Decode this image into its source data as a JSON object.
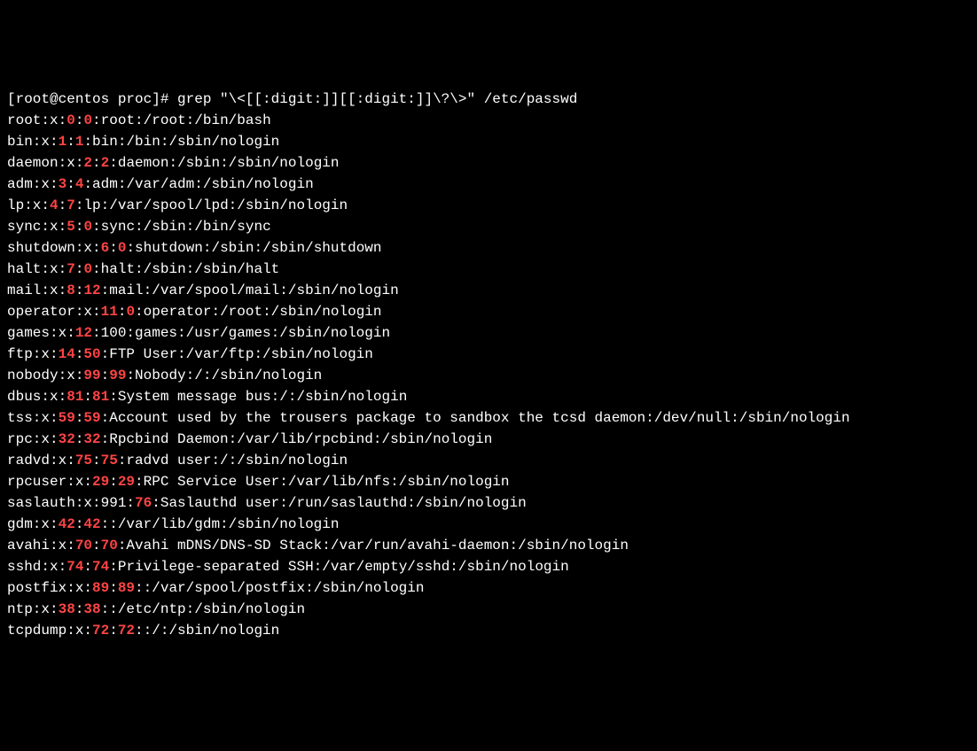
{
  "prompt": "[root@centos proc]# grep \"\\<[[:digit:]][[:digit:]]\\?\\>\" /etc/passwd",
  "lines": [
    {
      "segments": [
        {
          "t": "root:x:",
          "h": false
        },
        {
          "t": "0",
          "h": true
        },
        {
          "t": ":",
          "h": false
        },
        {
          "t": "0",
          "h": true
        },
        {
          "t": ":root:/root:/bin/bash",
          "h": false
        }
      ]
    },
    {
      "segments": [
        {
          "t": "bin:x:",
          "h": false
        },
        {
          "t": "1",
          "h": true
        },
        {
          "t": ":",
          "h": false
        },
        {
          "t": "1",
          "h": true
        },
        {
          "t": ":bin:/bin:/sbin/nologin",
          "h": false
        }
      ]
    },
    {
      "segments": [
        {
          "t": "daemon:x:",
          "h": false
        },
        {
          "t": "2",
          "h": true
        },
        {
          "t": ":",
          "h": false
        },
        {
          "t": "2",
          "h": true
        },
        {
          "t": ":daemon:/sbin:/sbin/nologin",
          "h": false
        }
      ]
    },
    {
      "segments": [
        {
          "t": "adm:x:",
          "h": false
        },
        {
          "t": "3",
          "h": true
        },
        {
          "t": ":",
          "h": false
        },
        {
          "t": "4",
          "h": true
        },
        {
          "t": ":adm:/var/adm:/sbin/nologin",
          "h": false
        }
      ]
    },
    {
      "segments": [
        {
          "t": "lp:x:",
          "h": false
        },
        {
          "t": "4",
          "h": true
        },
        {
          "t": ":",
          "h": false
        },
        {
          "t": "7",
          "h": true
        },
        {
          "t": ":lp:/var/spool/lpd:/sbin/nologin",
          "h": false
        }
      ]
    },
    {
      "segments": [
        {
          "t": "sync:x:",
          "h": false
        },
        {
          "t": "5",
          "h": true
        },
        {
          "t": ":",
          "h": false
        },
        {
          "t": "0",
          "h": true
        },
        {
          "t": ":sync:/sbin:/bin/sync",
          "h": false
        }
      ]
    },
    {
      "segments": [
        {
          "t": "shutdown:x:",
          "h": false
        },
        {
          "t": "6",
          "h": true
        },
        {
          "t": ":",
          "h": false
        },
        {
          "t": "0",
          "h": true
        },
        {
          "t": ":shutdown:/sbin:/sbin/shutdown",
          "h": false
        }
      ]
    },
    {
      "segments": [
        {
          "t": "halt:x:",
          "h": false
        },
        {
          "t": "7",
          "h": true
        },
        {
          "t": ":",
          "h": false
        },
        {
          "t": "0",
          "h": true
        },
        {
          "t": ":halt:/sbin:/sbin/halt",
          "h": false
        }
      ]
    },
    {
      "segments": [
        {
          "t": "mail:x:",
          "h": false
        },
        {
          "t": "8",
          "h": true
        },
        {
          "t": ":",
          "h": false
        },
        {
          "t": "12",
          "h": true
        },
        {
          "t": ":mail:/var/spool/mail:/sbin/nologin",
          "h": false
        }
      ]
    },
    {
      "segments": [
        {
          "t": "operator:x:",
          "h": false
        },
        {
          "t": "11",
          "h": true
        },
        {
          "t": ":",
          "h": false
        },
        {
          "t": "0",
          "h": true
        },
        {
          "t": ":operator:/root:/sbin/nologin",
          "h": false
        }
      ]
    },
    {
      "segments": [
        {
          "t": "games:x:",
          "h": false
        },
        {
          "t": "12",
          "h": true
        },
        {
          "t": ":100:games:/usr/games:/sbin/nologin",
          "h": false
        }
      ]
    },
    {
      "segments": [
        {
          "t": "ftp:x:",
          "h": false
        },
        {
          "t": "14",
          "h": true
        },
        {
          "t": ":",
          "h": false
        },
        {
          "t": "50",
          "h": true
        },
        {
          "t": ":FTP User:/var/ftp:/sbin/nologin",
          "h": false
        }
      ]
    },
    {
      "segments": [
        {
          "t": "nobody:x:",
          "h": false
        },
        {
          "t": "99",
          "h": true
        },
        {
          "t": ":",
          "h": false
        },
        {
          "t": "99",
          "h": true
        },
        {
          "t": ":Nobody:/:/sbin/nologin",
          "h": false
        }
      ]
    },
    {
      "segments": [
        {
          "t": "dbus:x:",
          "h": false
        },
        {
          "t": "81",
          "h": true
        },
        {
          "t": ":",
          "h": false
        },
        {
          "t": "81",
          "h": true
        },
        {
          "t": ":System message bus:/:/sbin/nologin",
          "h": false
        }
      ]
    },
    {
      "segments": [
        {
          "t": "tss:x:",
          "h": false
        },
        {
          "t": "59",
          "h": true
        },
        {
          "t": ":",
          "h": false
        },
        {
          "t": "59",
          "h": true
        },
        {
          "t": ":Account used by the trousers package to sandbox the tcsd daemon:/dev/null:/sbin/nologin",
          "h": false
        }
      ]
    },
    {
      "segments": [
        {
          "t": "rpc:x:",
          "h": false
        },
        {
          "t": "32",
          "h": true
        },
        {
          "t": ":",
          "h": false
        },
        {
          "t": "32",
          "h": true
        },
        {
          "t": ":Rpcbind Daemon:/var/lib/rpcbind:/sbin/nologin",
          "h": false
        }
      ]
    },
    {
      "segments": [
        {
          "t": "radvd:x:",
          "h": false
        },
        {
          "t": "75",
          "h": true
        },
        {
          "t": ":",
          "h": false
        },
        {
          "t": "75",
          "h": true
        },
        {
          "t": ":radvd user:/:/sbin/nologin",
          "h": false
        }
      ]
    },
    {
      "segments": [
        {
          "t": "rpcuser:x:",
          "h": false
        },
        {
          "t": "29",
          "h": true
        },
        {
          "t": ":",
          "h": false
        },
        {
          "t": "29",
          "h": true
        },
        {
          "t": ":RPC Service User:/var/lib/nfs:/sbin/nologin",
          "h": false
        }
      ]
    },
    {
      "segments": [
        {
          "t": "saslauth:x:991:",
          "h": false
        },
        {
          "t": "76",
          "h": true
        },
        {
          "t": ":Saslauthd user:/run/saslauthd:/sbin/nologin",
          "h": false
        }
      ]
    },
    {
      "segments": [
        {
          "t": "gdm:x:",
          "h": false
        },
        {
          "t": "42",
          "h": true
        },
        {
          "t": ":",
          "h": false
        },
        {
          "t": "42",
          "h": true
        },
        {
          "t": "::/var/lib/gdm:/sbin/nologin",
          "h": false
        }
      ]
    },
    {
      "segments": [
        {
          "t": "avahi:x:",
          "h": false
        },
        {
          "t": "70",
          "h": true
        },
        {
          "t": ":",
          "h": false
        },
        {
          "t": "70",
          "h": true
        },
        {
          "t": ":Avahi mDNS/DNS-SD Stack:/var/run/avahi-daemon:/sbin/nologin",
          "h": false
        }
      ]
    },
    {
      "segments": [
        {
          "t": "sshd:x:",
          "h": false
        },
        {
          "t": "74",
          "h": true
        },
        {
          "t": ":",
          "h": false
        },
        {
          "t": "74",
          "h": true
        },
        {
          "t": ":Privilege-separated SSH:/var/empty/sshd:/sbin/nologin",
          "h": false
        }
      ]
    },
    {
      "segments": [
        {
          "t": "postfix:x:",
          "h": false
        },
        {
          "t": "89",
          "h": true
        },
        {
          "t": ":",
          "h": false
        },
        {
          "t": "89",
          "h": true
        },
        {
          "t": "::/var/spool/postfix:/sbin/nologin",
          "h": false
        }
      ]
    },
    {
      "segments": [
        {
          "t": "ntp:x:",
          "h": false
        },
        {
          "t": "38",
          "h": true
        },
        {
          "t": ":",
          "h": false
        },
        {
          "t": "38",
          "h": true
        },
        {
          "t": "::/etc/ntp:/sbin/nologin",
          "h": false
        }
      ]
    },
    {
      "segments": [
        {
          "t": "tcpdump:x:",
          "h": false
        },
        {
          "t": "72",
          "h": true
        },
        {
          "t": ":",
          "h": false
        },
        {
          "t": "72",
          "h": true
        },
        {
          "t": "::/:/sbin/nologin",
          "h": false
        }
      ]
    }
  ]
}
